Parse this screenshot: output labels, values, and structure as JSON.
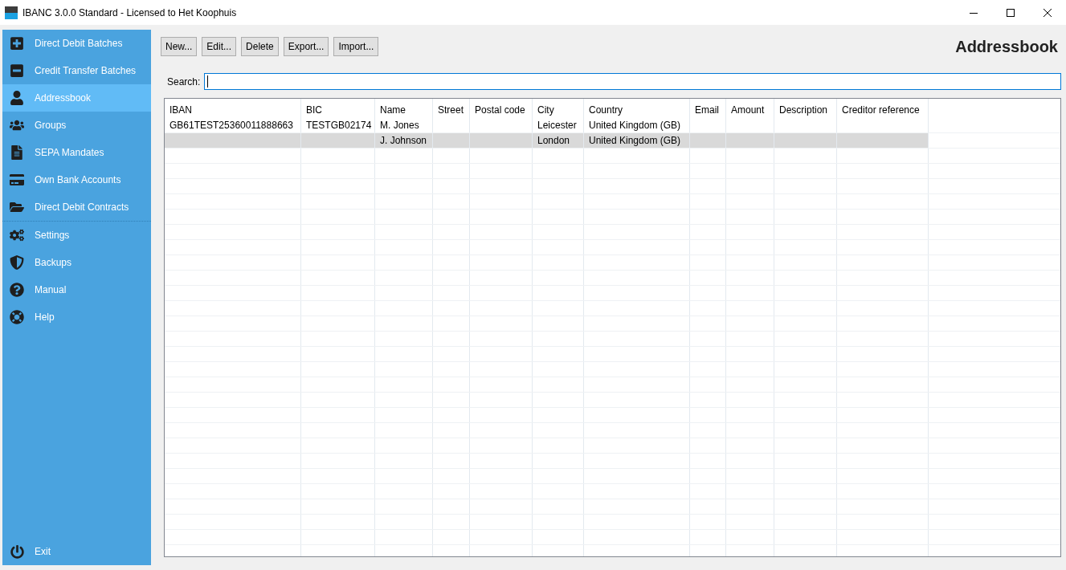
{
  "window": {
    "title": "IBANC 3.0.0 Standard - Licensed to Het Koophuis"
  },
  "sidebar": {
    "sections": [
      {
        "items": [
          {
            "label": "Direct Debit Batches",
            "selected": false
          },
          {
            "label": "Credit Transfer Batches",
            "selected": false
          },
          {
            "label": "Addressbook",
            "selected": true
          },
          {
            "label": "Groups",
            "selected": false
          },
          {
            "label": "SEPA Mandates",
            "selected": false
          },
          {
            "label": "Own Bank Accounts",
            "selected": false
          },
          {
            "label": "Direct Debit Contracts",
            "selected": false
          }
        ]
      },
      {
        "items": [
          {
            "label": "Settings",
            "selected": false
          },
          {
            "label": "Backups",
            "selected": false
          },
          {
            "label": "Manual",
            "selected": false
          },
          {
            "label": "Help",
            "selected": false
          }
        ]
      }
    ],
    "exit": {
      "label": "Exit"
    }
  },
  "toolbar": {
    "buttons": [
      "New...",
      "Edit...",
      "Delete",
      "Export...",
      "Import..."
    ]
  },
  "page_title": "Addressbook",
  "search": {
    "label": "Search:"
  },
  "table": {
    "columns": [
      "IBAN",
      "BIC",
      "Name",
      "Street",
      "Postal code",
      "City",
      "Country",
      "Email",
      "Amount",
      "Description",
      "Creditor reference"
    ],
    "rows": [
      {
        "selected": false,
        "cells": [
          "GB61TEST25360011888663",
          "TESTGB02174",
          "M. Jones",
          "",
          "",
          "Leicester",
          "United Kingdom (GB)",
          "",
          "",
          "",
          ""
        ]
      },
      {
        "selected": true,
        "cells": [
          "",
          "",
          "J. Johnson",
          "",
          "",
          "London",
          "United Kingdom (GB)",
          "",
          "",
          "",
          ""
        ]
      }
    ]
  }
}
